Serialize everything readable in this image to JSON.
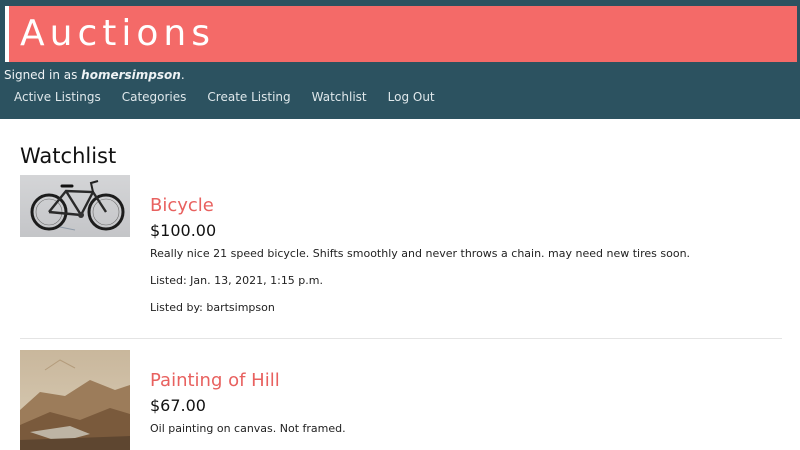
{
  "header": {
    "banner_title": "Auctions",
    "signed_in_prefix": "Signed in as ",
    "username": "homersimpson",
    "signed_in_suffix": "."
  },
  "nav": {
    "items": [
      {
        "label": "Active Listings"
      },
      {
        "label": "Categories"
      },
      {
        "label": "Create Listing"
      },
      {
        "label": "Watchlist"
      },
      {
        "label": "Log Out"
      }
    ]
  },
  "main": {
    "title": "Watchlist",
    "listings": [
      {
        "title": "Bicycle",
        "price": "$100.00",
        "description": "Really nice 21 speed bicycle. Shifts smoothly and never throws a chain. may need new tires soon.",
        "listed_date": "Listed: Jan. 13, 2021, 1:15 p.m.",
        "listed_by": "Listed by: bartsimpson"
      },
      {
        "title": "Painting of Hill",
        "price": "$67.00",
        "description": "Oil painting on canvas. Not framed."
      }
    ]
  },
  "colors": {
    "header_bg": "#2c5260",
    "banner_bg": "#f46a68",
    "title_link": "#e8615f"
  }
}
